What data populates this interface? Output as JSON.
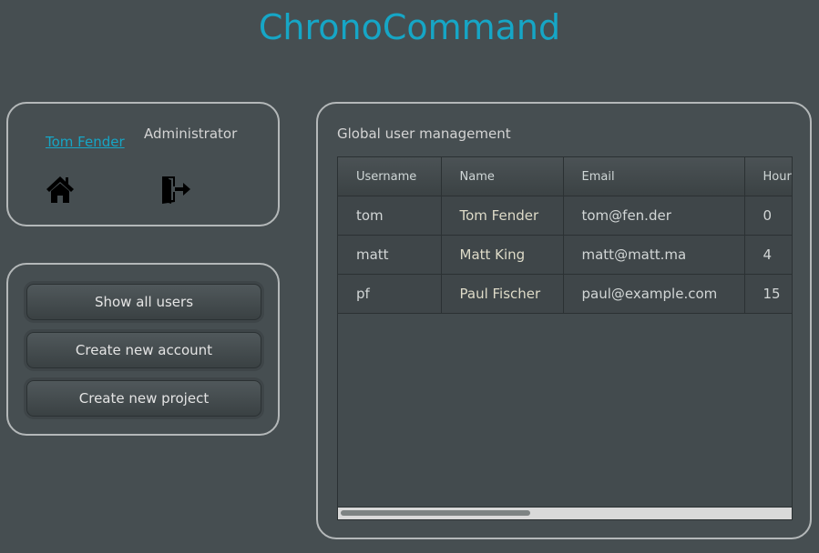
{
  "app": {
    "title": "ChronoCommand"
  },
  "user": {
    "name": "Tom Fender",
    "role": "Administrator"
  },
  "icons": {
    "home": "home-icon",
    "logout": "logout-icon"
  },
  "actions": [
    "Show all users",
    "Create new account",
    "Create new project"
  ],
  "main": {
    "label": "Global user management",
    "columns": [
      "Username",
      "Name",
      "Email",
      "Hours"
    ],
    "rows": [
      [
        "tom",
        "Tom Fender",
        "tom@fen.der",
        "0"
      ],
      [
        "matt",
        "Matt King",
        "matt@matt.ma",
        "4"
      ],
      [
        "pf",
        "Paul Fischer",
        "paul@example.com",
        "15"
      ]
    ]
  },
  "colors": {
    "accent": "#16a6c6",
    "background": "#464e51"
  }
}
